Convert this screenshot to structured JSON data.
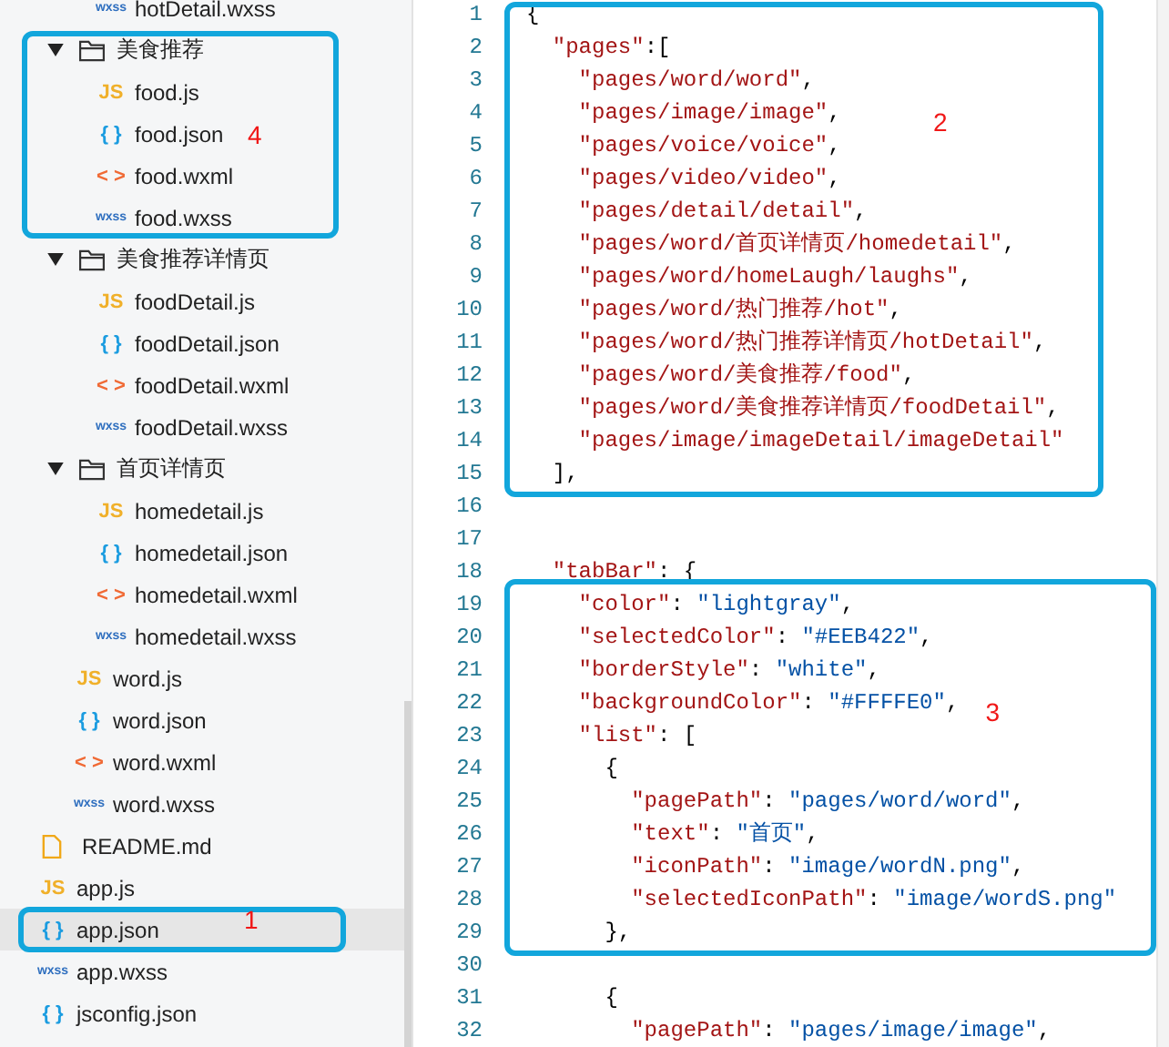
{
  "sidebar": {
    "tree": [
      {
        "children": [
          {
            "children": [
              {
                "kind": "wxss",
                "icon": "wxss",
                "name": "hotDetail.wxss"
              }
            ]
          },
          {
            "kind": "folder",
            "name": "美食推荐",
            "expanded": true,
            "annotation": "4",
            "children": [
              {
                "kind": "js",
                "icon": "JS",
                "name": "food.js"
              },
              {
                "kind": "json",
                "icon": "{ }",
                "name": "food.json"
              },
              {
                "kind": "wxml",
                "icon": "< >",
                "name": "food.wxml"
              },
              {
                "kind": "wxss",
                "icon": "wxss",
                "name": "food.wxss"
              }
            ]
          },
          {
            "kind": "folder",
            "name": "美食推荐详情页",
            "expanded": true,
            "children": [
              {
                "kind": "js",
                "icon": "JS",
                "name": "foodDetail.js"
              },
              {
                "kind": "json",
                "icon": "{ }",
                "name": "foodDetail.json"
              },
              {
                "kind": "wxml",
                "icon": "< >",
                "name": "foodDetail.wxml"
              },
              {
                "kind": "wxss",
                "icon": "wxss",
                "name": "foodDetail.wxss"
              }
            ]
          },
          {
            "kind": "folder",
            "name": "首页详情页",
            "expanded": true,
            "children": [
              {
                "kind": "js",
                "icon": "JS",
                "name": "homedetail.js"
              },
              {
                "kind": "json",
                "icon": "{ }",
                "name": "homedetail.json"
              },
              {
                "kind": "wxml",
                "icon": "< >",
                "name": "homedetail.wxml"
              },
              {
                "kind": "wxss",
                "icon": "wxss",
                "name": "homedetail.wxss"
              }
            ]
          },
          {
            "kind": "js",
            "icon": "JS",
            "name": "word.js"
          },
          {
            "kind": "json",
            "icon": "{ }",
            "name": "word.json"
          },
          {
            "kind": "wxml",
            "icon": "< >",
            "name": "word.wxml"
          },
          {
            "kind": "wxss",
            "icon": "wxss",
            "name": "word.wxss"
          }
        ]
      },
      {
        "kind": "md",
        "name": "README.md",
        "selected": false
      },
      {
        "kind": "js",
        "icon": "JS",
        "name": "app.js",
        "selected": false
      },
      {
        "kind": "json",
        "icon": "{ }",
        "name": "app.json",
        "selected": true,
        "annotation": "1"
      },
      {
        "kind": "wxss",
        "icon": "wxss",
        "name": "app.wxss",
        "selected": false
      },
      {
        "kind": "json",
        "icon": "{ }",
        "name": "jsconfig.json",
        "selected": false
      }
    ]
  },
  "editor": {
    "blocks": [
      {
        "annotation": "2",
        "lines": [
          {
            "number": "1",
            "tokens": [
              {
                "kind": "punct",
                "text": "{"
              }
            ]
          },
          {
            "number": "2",
            "tokens": [
              {
                "kind": "key",
                "text": "  \"pages\""
              },
              {
                "kind": "punct",
                "text": ":["
              }
            ]
          },
          {
            "number": "3",
            "tokens": [
              {
                "kind": "string",
                "text": "    \"pages/word/word\""
              },
              {
                "kind": "punct",
                "text": ","
              }
            ]
          },
          {
            "number": "4",
            "tokens": [
              {
                "kind": "string",
                "text": "    \"pages/image/image\""
              },
              {
                "kind": "punct",
                "text": ","
              }
            ]
          },
          {
            "number": "5",
            "tokens": [
              {
                "kind": "string",
                "text": "    \"pages/voice/voice\""
              },
              {
                "kind": "punct",
                "text": ","
              }
            ]
          },
          {
            "number": "6",
            "tokens": [
              {
                "kind": "string",
                "text": "    \"pages/video/video\""
              },
              {
                "kind": "punct",
                "text": ","
              }
            ]
          },
          {
            "number": "7",
            "tokens": [
              {
                "kind": "string",
                "text": "    \"pages/detail/detail\""
              },
              {
                "kind": "punct",
                "text": ","
              }
            ]
          },
          {
            "number": "8",
            "tokens": [
              {
                "kind": "string",
                "text": "    \"pages/word/首页详情页/homedetail\""
              },
              {
                "kind": "punct",
                "text": ","
              }
            ]
          },
          {
            "number": "9",
            "tokens": [
              {
                "kind": "string",
                "text": "    \"pages/word/homeLaugh/laughs\""
              },
              {
                "kind": "punct",
                "text": ","
              }
            ]
          },
          {
            "number": "10",
            "tokens": [
              {
                "kind": "string",
                "text": "    \"pages/word/热门推荐/hot\""
              },
              {
                "kind": "punct",
                "text": ","
              }
            ]
          },
          {
            "number": "11",
            "tokens": [
              {
                "kind": "string",
                "text": "    \"pages/word/热门推荐详情页/hotDetail\""
              },
              {
                "kind": "punct",
                "text": ","
              }
            ]
          },
          {
            "number": "12",
            "tokens": [
              {
                "kind": "string",
                "text": "    \"pages/word/美食推荐/food\""
              },
              {
                "kind": "punct",
                "text": ","
              }
            ]
          },
          {
            "number": "13",
            "tokens": [
              {
                "kind": "string",
                "text": "    \"pages/word/美食推荐详情页/foodDetail\""
              },
              {
                "kind": "punct",
                "text": ","
              }
            ]
          },
          {
            "number": "14",
            "tokens": [
              {
                "kind": "string",
                "text": "    \"pages/image/imageDetail/imageDetail\""
              }
            ]
          },
          {
            "number": "15",
            "tokens": [
              {
                "kind": "punct",
                "text": "  ],"
              }
            ]
          }
        ]
      },
      {
        "lines": [
          {
            "number": "16"
          },
          {
            "number": "17"
          },
          {
            "number": "18",
            "tokens": [
              {
                "kind": "key",
                "text": "  \"tabBar\""
              },
              {
                "kind": "punct",
                "text": ": {"
              }
            ]
          }
        ]
      },
      {
        "annotation": "3",
        "lines": [
          {
            "number": "19",
            "tokens": [
              {
                "kind": "key",
                "text": "    \"color\""
              },
              {
                "kind": "punct",
                "text": ": "
              },
              {
                "kind": "value",
                "text": "\"lightgray\""
              },
              {
                "kind": "punct",
                "text": ","
              }
            ]
          },
          {
            "number": "20",
            "tokens": [
              {
                "kind": "key",
                "text": "    \"selectedColor\""
              },
              {
                "kind": "punct",
                "text": ": "
              },
              {
                "kind": "value",
                "text": "\"#EEB422\""
              },
              {
                "kind": "punct",
                "text": ","
              }
            ]
          },
          {
            "number": "21",
            "tokens": [
              {
                "kind": "key",
                "text": "    \"borderStyle\""
              },
              {
                "kind": "punct",
                "text": ": "
              },
              {
                "kind": "value",
                "text": "\"white\""
              },
              {
                "kind": "punct",
                "text": ","
              }
            ]
          },
          {
            "number": "22",
            "tokens": [
              {
                "kind": "key",
                "text": "    \"backgroundColor\""
              },
              {
                "kind": "punct",
                "text": ": "
              },
              {
                "kind": "value",
                "text": "\"#FFFFE0\""
              },
              {
                "kind": "punct",
                "text": ","
              }
            ]
          },
          {
            "number": "23",
            "tokens": [
              {
                "kind": "key",
                "text": "    \"list\""
              },
              {
                "kind": "punct",
                "text": ": ["
              }
            ]
          },
          {
            "number": "24",
            "tokens": [
              {
                "kind": "punct",
                "text": "      {"
              }
            ]
          },
          {
            "number": "25",
            "tokens": [
              {
                "kind": "key",
                "text": "        \"pagePath\""
              },
              {
                "kind": "punct",
                "text": ": "
              },
              {
                "kind": "value",
                "text": "\"pages/word/word\""
              },
              {
                "kind": "punct",
                "text": ","
              }
            ]
          },
          {
            "number": "26",
            "tokens": [
              {
                "kind": "key",
                "text": "        \"text\""
              },
              {
                "kind": "punct",
                "text": ": "
              },
              {
                "kind": "value",
                "text": "\"首页\""
              },
              {
                "kind": "punct",
                "text": ","
              }
            ]
          },
          {
            "number": "27",
            "tokens": [
              {
                "kind": "key",
                "text": "        \"iconPath\""
              },
              {
                "kind": "punct",
                "text": ": "
              },
              {
                "kind": "value",
                "text": "\"image/wordN.png\""
              },
              {
                "kind": "punct",
                "text": ","
              }
            ]
          },
          {
            "number": "28",
            "tokens": [
              {
                "kind": "key",
                "text": "        \"selectedIconPath\""
              },
              {
                "kind": "punct",
                "text": ": "
              },
              {
                "kind": "value",
                "text": "\"image/wordS.png\""
              }
            ]
          },
          {
            "number": "29",
            "tokens": [
              {
                "kind": "punct",
                "text": "      },"
              }
            ]
          }
        ]
      },
      {
        "lines": [
          {
            "number": "30"
          },
          {
            "number": "31",
            "tokens": [
              {
                "kind": "punct",
                "text": "      {"
              }
            ]
          },
          {
            "number": "32",
            "tokens": [
              {
                "kind": "key",
                "text": "        \"pagePath\""
              },
              {
                "kind": "punct",
                "text": ": "
              },
              {
                "kind": "value",
                "text": "\"pages/image/image\""
              },
              {
                "kind": "punct",
                "text": ","
              }
            ]
          }
        ]
      }
    ]
  }
}
